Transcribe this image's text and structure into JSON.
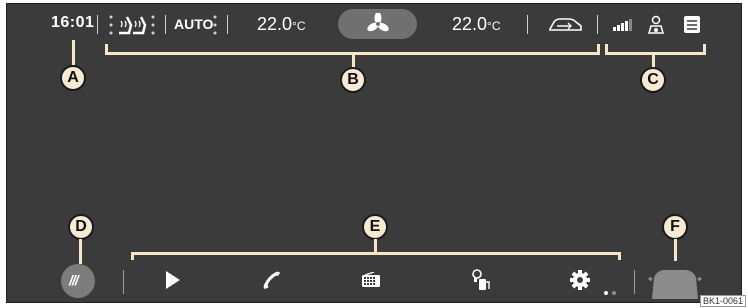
{
  "status_bar": {
    "time": "16:01",
    "mode": "AUTO",
    "temp_left": "22.0",
    "temp_right": "22.0",
    "temp_unit": "°C"
  },
  "callouts": {
    "a": "A",
    "b": "B",
    "c": "C",
    "d": "D",
    "e": "E",
    "f": "F"
  },
  "bottom_bar": {
    "menu_glyph": "///",
    "icons": [
      "play-icon",
      "phone-icon",
      "radio-icon",
      "fuel-station-icon",
      "gear-icon"
    ],
    "page_indicator": {
      "current": 1,
      "total": 2
    }
  },
  "figure_code": "BK1-0061",
  "colors": {
    "screen": "#3b3b3b",
    "callout_fill": "#f6ead2",
    "callout_line": "#f5e7c8",
    "button_grey": "#7c7c7c"
  }
}
